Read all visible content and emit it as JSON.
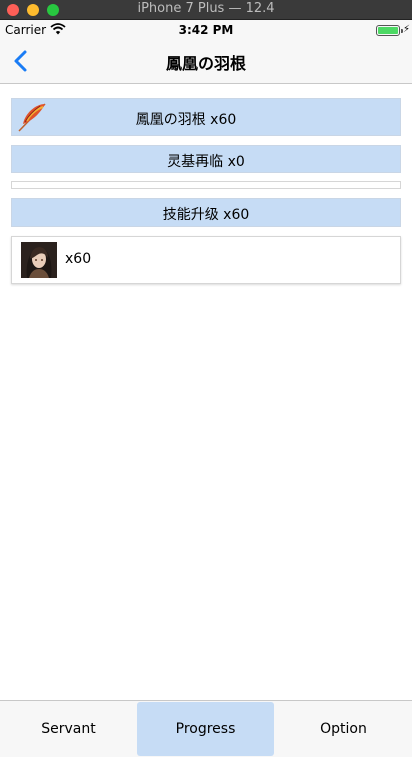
{
  "window": {
    "title": "iPhone 7 Plus — 12.4"
  },
  "status": {
    "carrier": "Carrier",
    "time": "3:42 PM"
  },
  "nav": {
    "title": "鳳凰の羽根"
  },
  "rows": [
    {
      "label": "鳳凰の羽根  x60"
    },
    {
      "label": "灵基再临  x0"
    },
    {
      "label": ""
    },
    {
      "label": "技能升级  x60"
    },
    {
      "label": "x60"
    }
  ],
  "tabs": [
    {
      "label": "Servant"
    },
    {
      "label": "Progress",
      "selected": true
    },
    {
      "label": "Option"
    }
  ],
  "colors": {
    "accent": "#c6dcf5",
    "tint": "#1a7cf5"
  }
}
